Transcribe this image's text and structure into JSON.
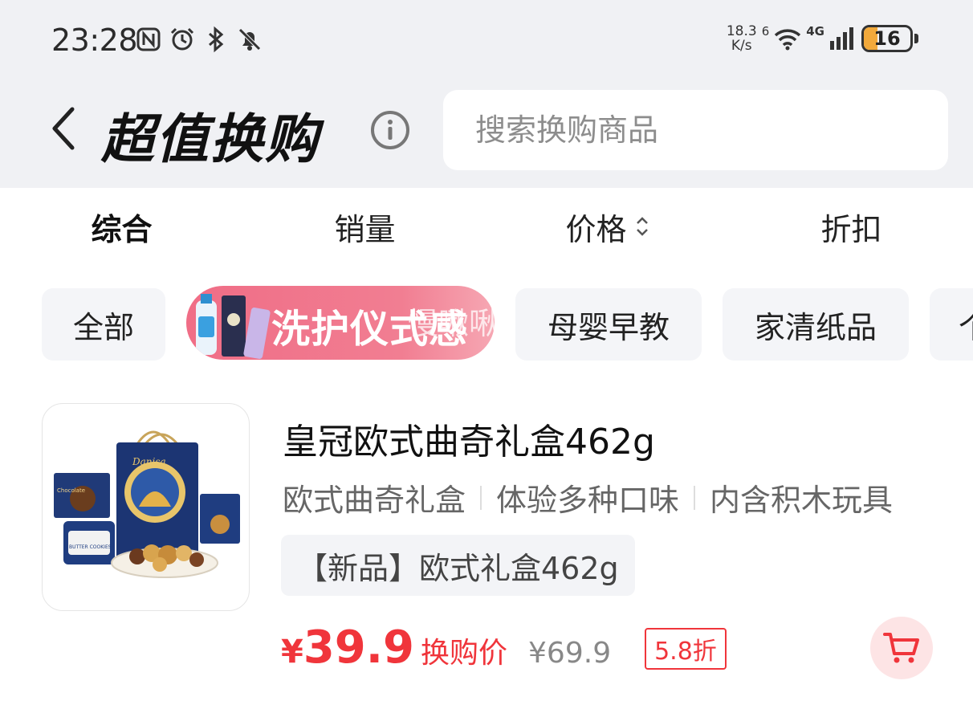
{
  "status_bar": {
    "time": "23:28",
    "network_speed_value": "18.3",
    "network_speed_unit": "K/s",
    "wifi_badge": "6",
    "cellular_badge": "4G",
    "battery_level": "16",
    "battery_color": "#f2a93b"
  },
  "header": {
    "title": "超值换购",
    "search_placeholder": "搜索换购商品"
  },
  "sort_tabs": [
    {
      "label": "综合",
      "active": true
    },
    {
      "label": "销量",
      "active": false
    },
    {
      "label": "价格",
      "active": false
    },
    {
      "label": "折扣",
      "active": false
    }
  ],
  "category_chips": {
    "all": "全部",
    "banner_text": "洗护仪式感",
    "watermark": "慢啾啾",
    "mother_baby": "母婴早教",
    "home_paper": "家清纸品",
    "partial": "个"
  },
  "product": {
    "title": "皇冠欧式曲奇礼盒462g",
    "tags": [
      "欧式曲奇礼盒",
      "体验多种口味",
      "内含积木玩具"
    ],
    "spec": "【新品】欧式礼盒462g",
    "currency": "¥",
    "price": "39.9",
    "price_label": "换购价",
    "original_price": "¥69.9",
    "discount": "5.8折",
    "image_brand": "Danisa",
    "image_box_label": "Chocolate",
    "image_tin_label": "BUTTER COOKIES",
    "accent_color": "#f0353b"
  }
}
